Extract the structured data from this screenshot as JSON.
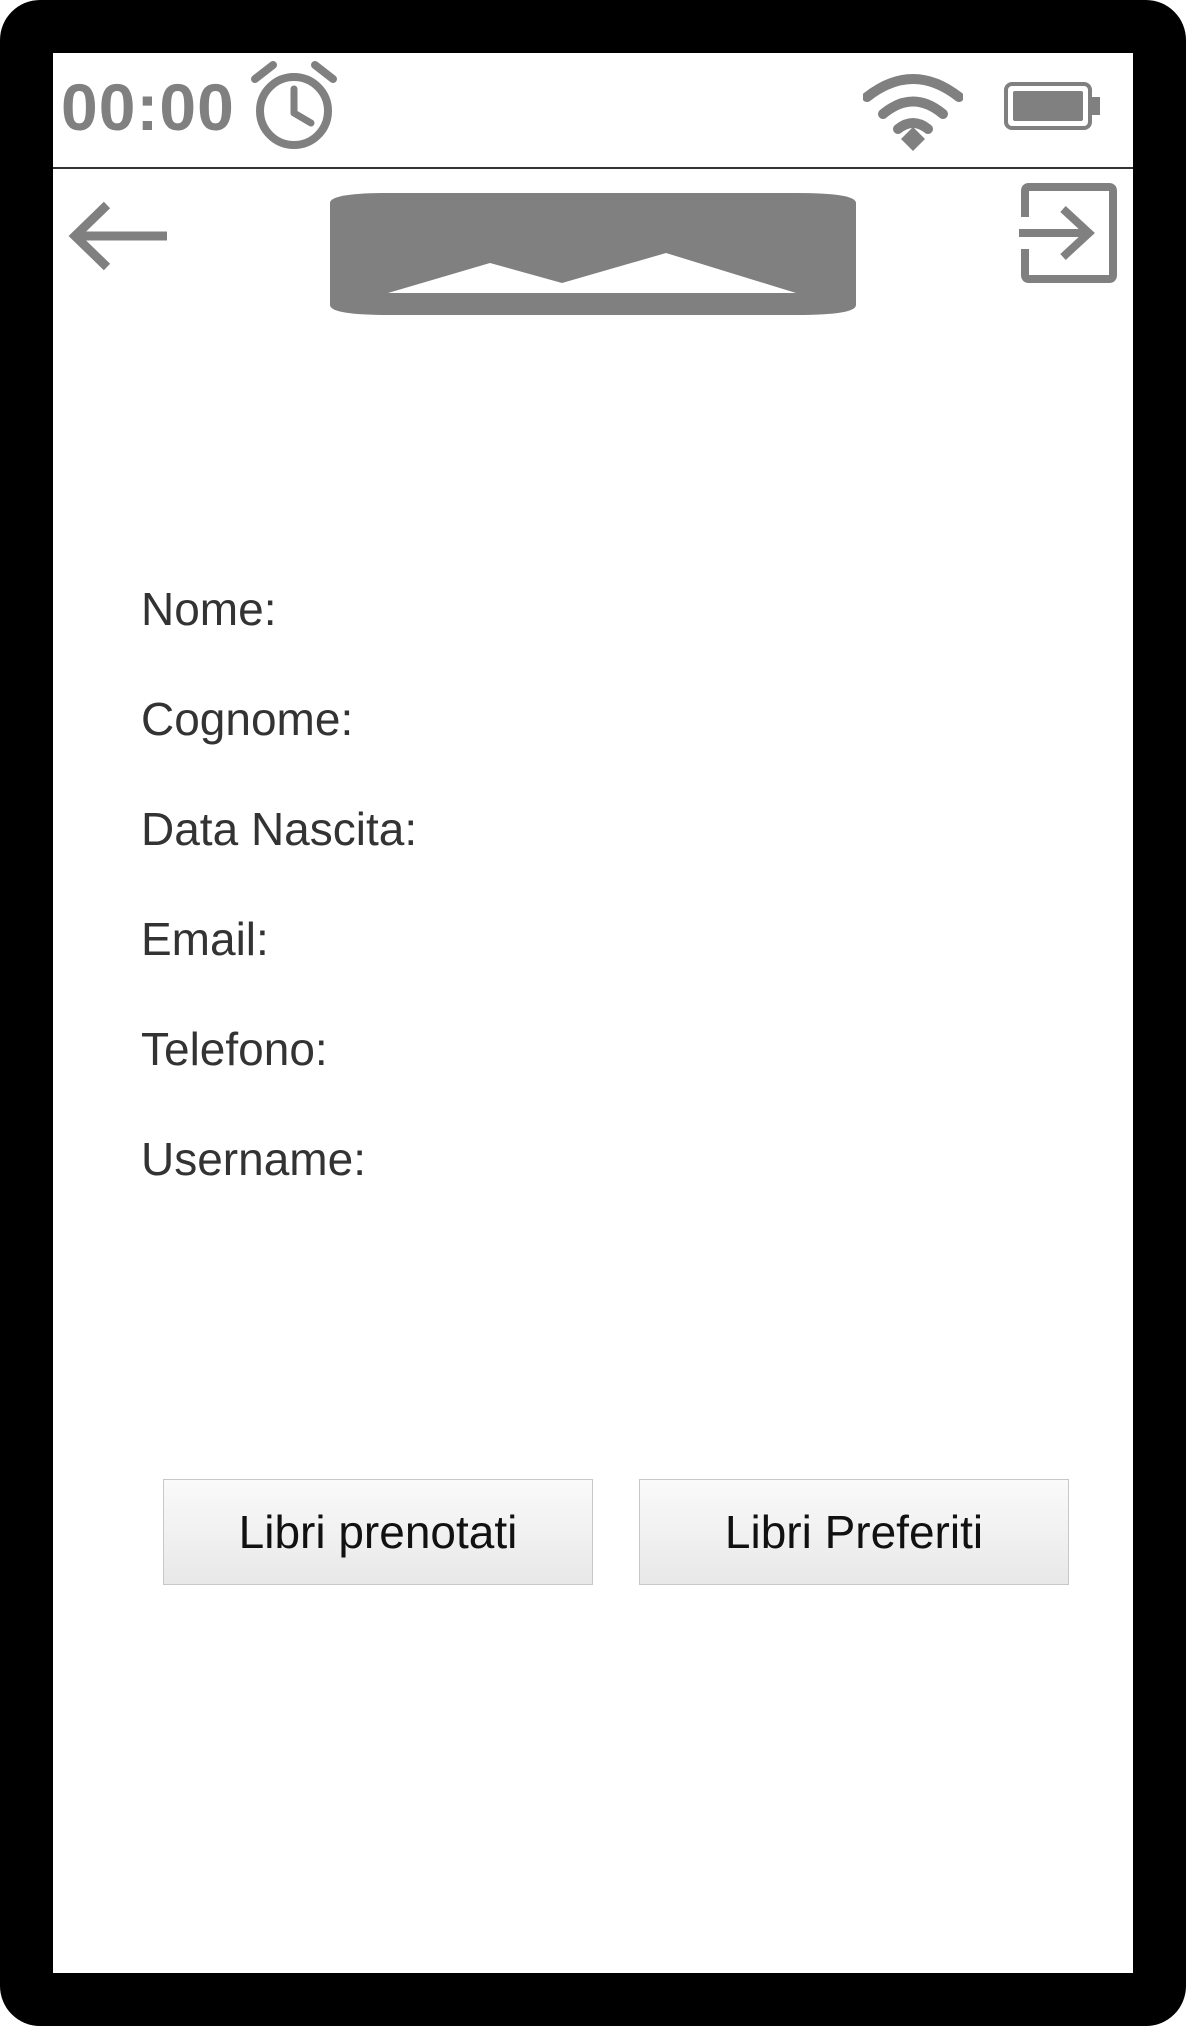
{
  "status_bar": {
    "time": "00:00",
    "icons": [
      "alarm-icon",
      "wifi-icon",
      "battery-icon"
    ]
  },
  "header": {
    "back_icon": "arrow-left-icon",
    "logo_icon": "image-placeholder-icon",
    "logout_icon": "logout-icon"
  },
  "profile": {
    "fields": [
      {
        "label": "Nome:"
      },
      {
        "label": "Cognome:"
      },
      {
        "label": "Data Nascita:"
      },
      {
        "label": "Email:"
      },
      {
        "label": "Telefono:"
      },
      {
        "label": "Username:"
      }
    ]
  },
  "actions": {
    "reserved_books_label": "Libri prenotati",
    "favorite_books_label": "Libri Preferiti"
  },
  "colors": {
    "frame": "#000000",
    "icon_gray": "#808080",
    "text": "#333333",
    "button_border": "#c8c8c8"
  }
}
